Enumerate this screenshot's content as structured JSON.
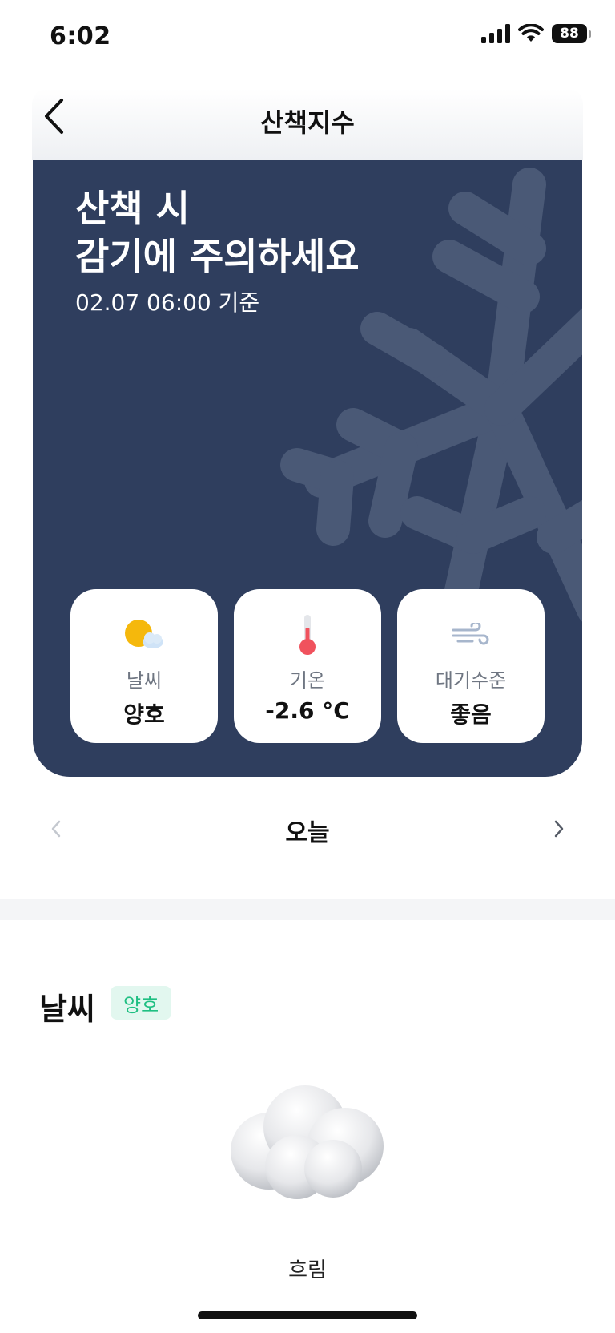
{
  "status_bar": {
    "time": "6:02",
    "battery": "88",
    "icons": [
      "cellular-signal-icon",
      "wifi-icon",
      "battery-icon"
    ]
  },
  "nav": {
    "title": "산책지수",
    "back_icon": "chevron-left-icon"
  },
  "hero": {
    "title_line1": "산책 시",
    "title_line2": "감기에 주의하세요",
    "date": "02.07 06:00 기준",
    "background_color": "#2f3e5e",
    "decoration_icon": "snowflake-icon"
  },
  "cards": [
    {
      "icon": "sun-behind-cloud-icon",
      "label": "날씨",
      "value": "양호"
    },
    {
      "icon": "thermometer-icon",
      "label": "기온",
      "value": "-2.6 °C"
    },
    {
      "icon": "wind-icon",
      "label": "대기수준",
      "value": "좋음"
    }
  ],
  "day_nav": {
    "label": "오늘",
    "prev_icon": "chevron-left-icon",
    "next_icon": "chevron-right-icon"
  },
  "weather_section": {
    "title": "날씨",
    "badge": "양호",
    "badge_color": "#1fbf82",
    "image": "cloud-icon",
    "description": "흐림"
  }
}
